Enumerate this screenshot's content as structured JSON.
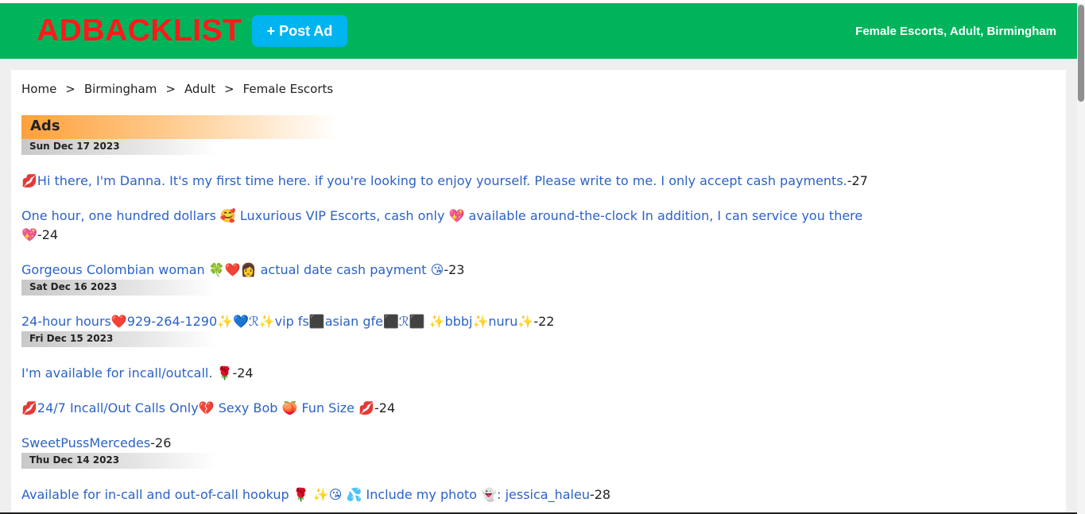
{
  "site": {
    "logo": "ADBACKLIST",
    "post_ad_label": "+ Post Ad",
    "category_title": "Female Escorts, Adult, Birmingham"
  },
  "breadcrumb": {
    "items": [
      "Home",
      "Birmingham",
      "Adult",
      "Female Escorts"
    ],
    "separator": ">"
  },
  "section": {
    "title": "Ads"
  },
  "dates": [
    "Sun Dec 17 2023",
    "Sat Dec 16 2023",
    "Fri Dec 15 2023",
    "Thu Dec 14 2023"
  ],
  "ads": [
    {
      "text": "💋Hi there, I'm Danna. It's my first time here. if you're looking to enjoy yourself. Please write to me. I only accept cash payments.",
      "count": "-27"
    },
    {
      "text": "One hour, one hundred dollars 🥰 Luxurious VIP Escorts, cash only 💖 available around-the-clock In addition, I can service you there 💖",
      "count": "-24"
    },
    {
      "text": "Gorgeous Colombian woman 🍀❤️👩 actual date cash payment 😘",
      "count": "-23"
    },
    {
      "text": "24-hour hours❤️929-264-1290✨💙ℛ✨vip fs⬛asian gfe⬛ℛ⬛ ✨bbbj✨nuru✨",
      "count": "-22"
    },
    {
      "text": "I'm available for incall/outcall. 🌹",
      "count": "-24"
    },
    {
      "text": "💋24/7 Incall/Out Calls Only💔 Sexy Bob 🍑 Fun Size 💋",
      "count": "-24"
    },
    {
      "text": "SweetPussMercedes",
      "count": "-26"
    },
    {
      "text": "Available for in-call and out-of-call hookup 🌹 ✨😘 💦 Include my photo 👻: jessica_haleu",
      "count": "-28"
    }
  ],
  "colors": {
    "header_bg": "#00b45b",
    "logo": "#ff1a1a",
    "post_ad_bg": "#00b4ef",
    "link": "#2c62c7",
    "ads_header_start": "#ffa03c"
  }
}
